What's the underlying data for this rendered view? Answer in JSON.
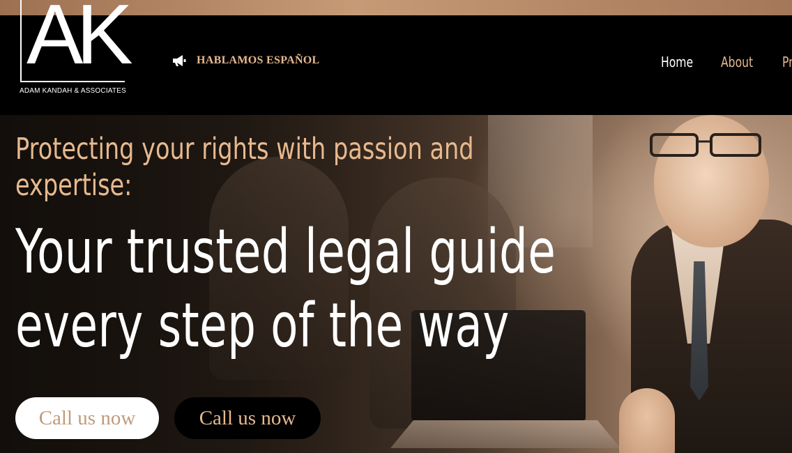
{
  "logo": {
    "mark": "AK",
    "name": "ADAM KANDAH & ASSOCIATES"
  },
  "header": {
    "spanish_label": "HABLAMOS ESPAÑOL",
    "spanish_icon": "megaphone-icon"
  },
  "nav": {
    "items": [
      {
        "label": "Home"
      },
      {
        "label": "About"
      },
      {
        "label": "Pr"
      }
    ]
  },
  "hero": {
    "tagline": "Protecting your rights with passion and expertise:",
    "headline": "Your trusted legal guide every step of the way",
    "buttons": [
      {
        "label": "Call us now"
      },
      {
        "label": "Call us now"
      }
    ]
  },
  "colors": {
    "accent": "#e7b98f",
    "header_bg": "#000000",
    "top_bar": "#c79a76",
    "button_light_bg": "#ffffff",
    "button_dark_bg": "#000000"
  }
}
